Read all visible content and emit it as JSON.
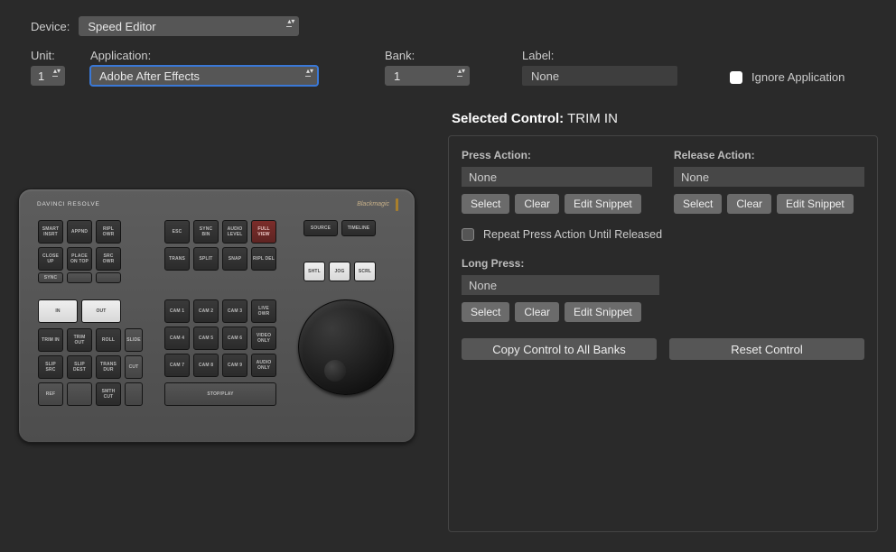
{
  "top": {
    "device_label": "Device:",
    "device_value": "Speed Editor",
    "unit_label": "Unit:",
    "unit_value": "1",
    "application_label": "Application:",
    "application_value": "Adobe After Effects",
    "bank_label": "Bank:",
    "bank_value": "1",
    "label_label": "Label:",
    "label_value": "None",
    "ignore_label": "Ignore Application"
  },
  "selected": {
    "prefix": "Selected Control:",
    "name": "TRIM IN"
  },
  "panel": {
    "press_label": "Press Action:",
    "release_label": "Release Action:",
    "long_label": "Long Press:",
    "none": "None",
    "select_btn": "Select",
    "clear_btn": "Clear",
    "edit_btn": "Edit Snippet",
    "repeat_label": "Repeat Press Action Until Released",
    "copy_btn": "Copy Control to All Banks",
    "reset_btn": "Reset Control"
  },
  "device": {
    "brand": "DAVINCI RESOLVE",
    "brand2": "Blackmagic"
  },
  "keys": {
    "r1": [
      "SMART INSRT",
      "APPND",
      "RIPL OWR"
    ],
    "r2": [
      "CLOSE UP",
      "PLACE ON TOP",
      "SRC OWR"
    ],
    "r3": [
      "SYNC",
      "",
      "",
      ""
    ],
    "mid_top": [
      "ESC",
      "SYNC BIN",
      "AUDIO LEVEL",
      "FULL VIEW"
    ],
    "mid_bot": [
      "TRANS",
      "SPLIT",
      "SNAP",
      "RIPL DEL"
    ],
    "right_top": [
      "SOURCE",
      "TIMELINE"
    ],
    "right_bot": [
      "SHTL",
      "JOG",
      "SCRL"
    ],
    "white_row": [
      "IN",
      "OUT"
    ],
    "left_grid": [
      [
        "TRIM IN",
        "TRIM OUT",
        "ROLL",
        "SLIDE"
      ],
      [
        "SLIP SRC",
        "SLIP DEST",
        "TRANS DUR",
        "CUT"
      ],
      [
        "REF",
        "",
        "SMTH CUT",
        ""
      ]
    ],
    "cam_grid": [
      [
        "CAM 1",
        "CAM 2",
        "CAM 3",
        "LIVE OWR"
      ],
      [
        "CAM 4",
        "CAM 5",
        "CAM 6",
        "VIDEO ONLY"
      ],
      [
        "CAM 7",
        "CAM 8",
        "CAM 9",
        "AUDIO ONLY"
      ]
    ],
    "stop_play": "STOP/PLAY"
  }
}
